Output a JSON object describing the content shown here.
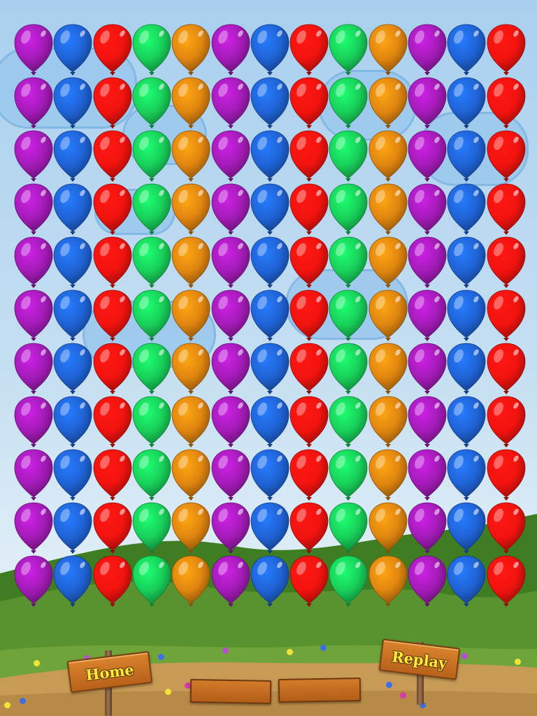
{
  "game": {
    "buttons": {
      "home_label": "Home",
      "replay_label": "Replay"
    },
    "balloon_grid": {
      "rows": 11,
      "columns": 13,
      "column_colors": [
        "purple",
        "blue",
        "red",
        "green",
        "orange",
        "purple",
        "blue",
        "red",
        "green",
        "orange",
        "purple",
        "blue",
        "red"
      ]
    },
    "palette": {
      "purple": "#a41bb8",
      "blue": "#1f63d6",
      "red": "#f2130f",
      "green": "#18d05a",
      "orange": "#e0850f",
      "sky": "#c7e0f2",
      "grass": "#4e8e2a",
      "dirt": "#c79a55",
      "sign_wood": "#c96e22",
      "sign_text": "#f6ee3a"
    }
  }
}
